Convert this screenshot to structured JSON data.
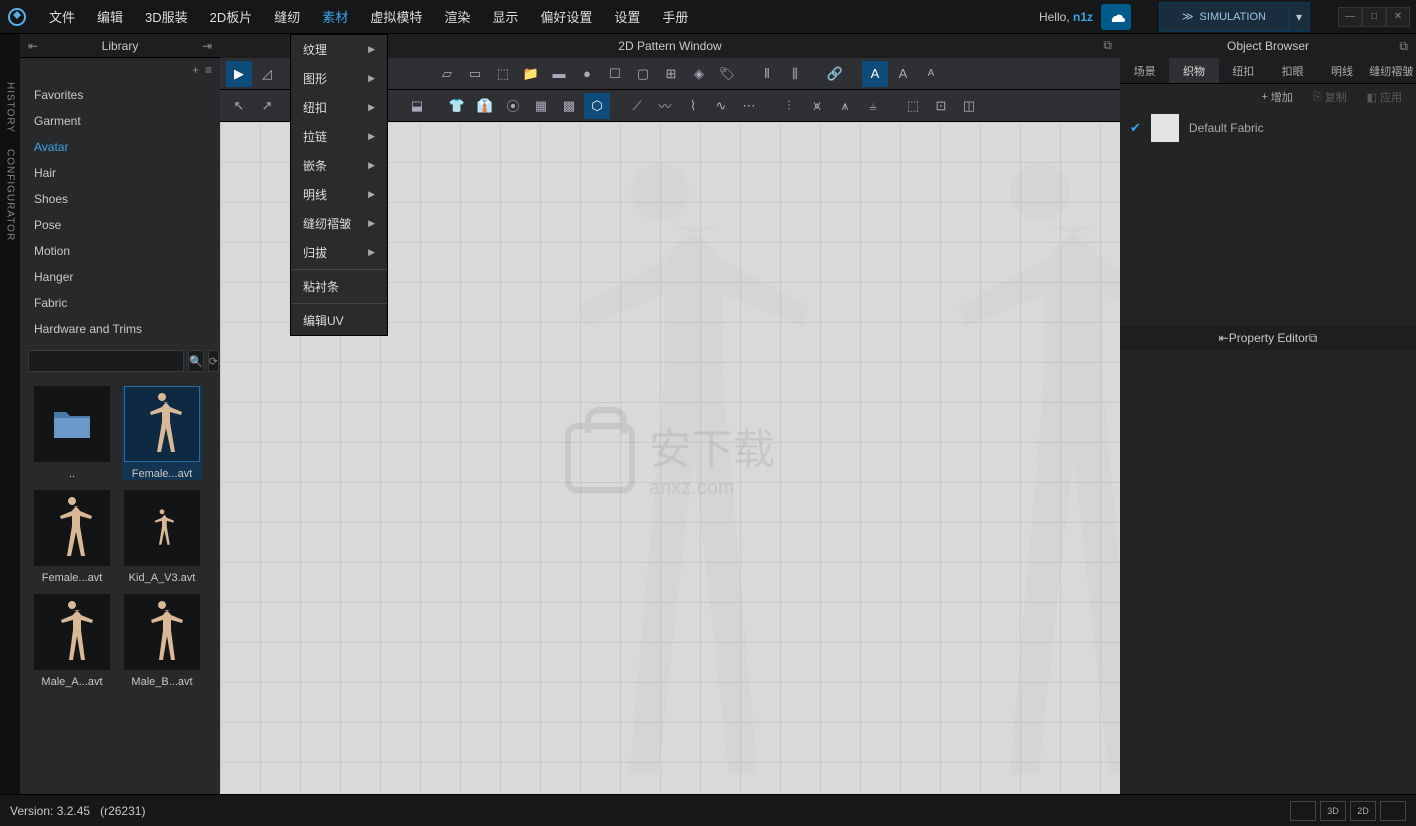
{
  "menubar": {
    "items": [
      "文件",
      "编辑",
      "3D服装",
      "2D板片",
      "缝纫",
      "素材",
      "虚拟模特",
      "渲染",
      "显示",
      "偏好设置",
      "设置",
      "手册"
    ],
    "active_index": 5,
    "hello_prefix": "Hello, ",
    "username": "n1z",
    "sim_label": "SIMULATION"
  },
  "dropdown": {
    "items": [
      {
        "label": "纹理",
        "arrow": true
      },
      {
        "label": "图形",
        "arrow": true
      },
      {
        "label": "纽扣",
        "arrow": true
      },
      {
        "label": "拉链",
        "arrow": true
      },
      {
        "label": "嵌条",
        "arrow": true
      },
      {
        "label": "明线",
        "arrow": true
      },
      {
        "label": "缝纫褶皱",
        "arrow": true
      },
      {
        "label": "归拔",
        "arrow": true
      },
      {
        "label": "粘衬条",
        "arrow": false
      },
      {
        "label": "编辑UV",
        "arrow": false
      }
    ]
  },
  "side_tabs": [
    "HISTORY",
    "CONFIGURATOR"
  ],
  "library": {
    "title": "Library",
    "categories": [
      "Favorites",
      "Garment",
      "Avatar",
      "Hair",
      "Shoes",
      "Pose",
      "Motion",
      "Hanger",
      "Fabric",
      "Hardware and Trims"
    ],
    "active_index": 2,
    "search_placeholder": "",
    "thumbs": [
      {
        "label": "..",
        "type": "folder",
        "selected": false
      },
      {
        "label": "Female...avt",
        "type": "body",
        "selected": true
      },
      {
        "label": "Female...avt",
        "type": "body",
        "selected": false
      },
      {
        "label": "Kid_A_V3.avt",
        "type": "kid",
        "selected": false
      },
      {
        "label": "Male_A...avt",
        "type": "body",
        "selected": false
      },
      {
        "label": "Male_B...avt",
        "type": "body",
        "selected": false
      }
    ]
  },
  "center": {
    "title": "2D Pattern Window",
    "watermark_text": "安下载",
    "watermark_sub": "anxz.com"
  },
  "object_browser": {
    "title": "Object Browser",
    "tabs": [
      "场景",
      "织物",
      "纽扣",
      "扣眼",
      "明线",
      "缝纫褶皱"
    ],
    "active_tab": 1,
    "add_label": "增加",
    "copy_label": "复制",
    "apply_label": "应用",
    "item_name": "Default Fabric"
  },
  "property_editor": {
    "title": "Property Editor"
  },
  "statusbar": {
    "version_label": "Version: 3.2.45",
    "build_label": "(r26231)",
    "modes": [
      "",
      "3D",
      "2D",
      ""
    ]
  }
}
